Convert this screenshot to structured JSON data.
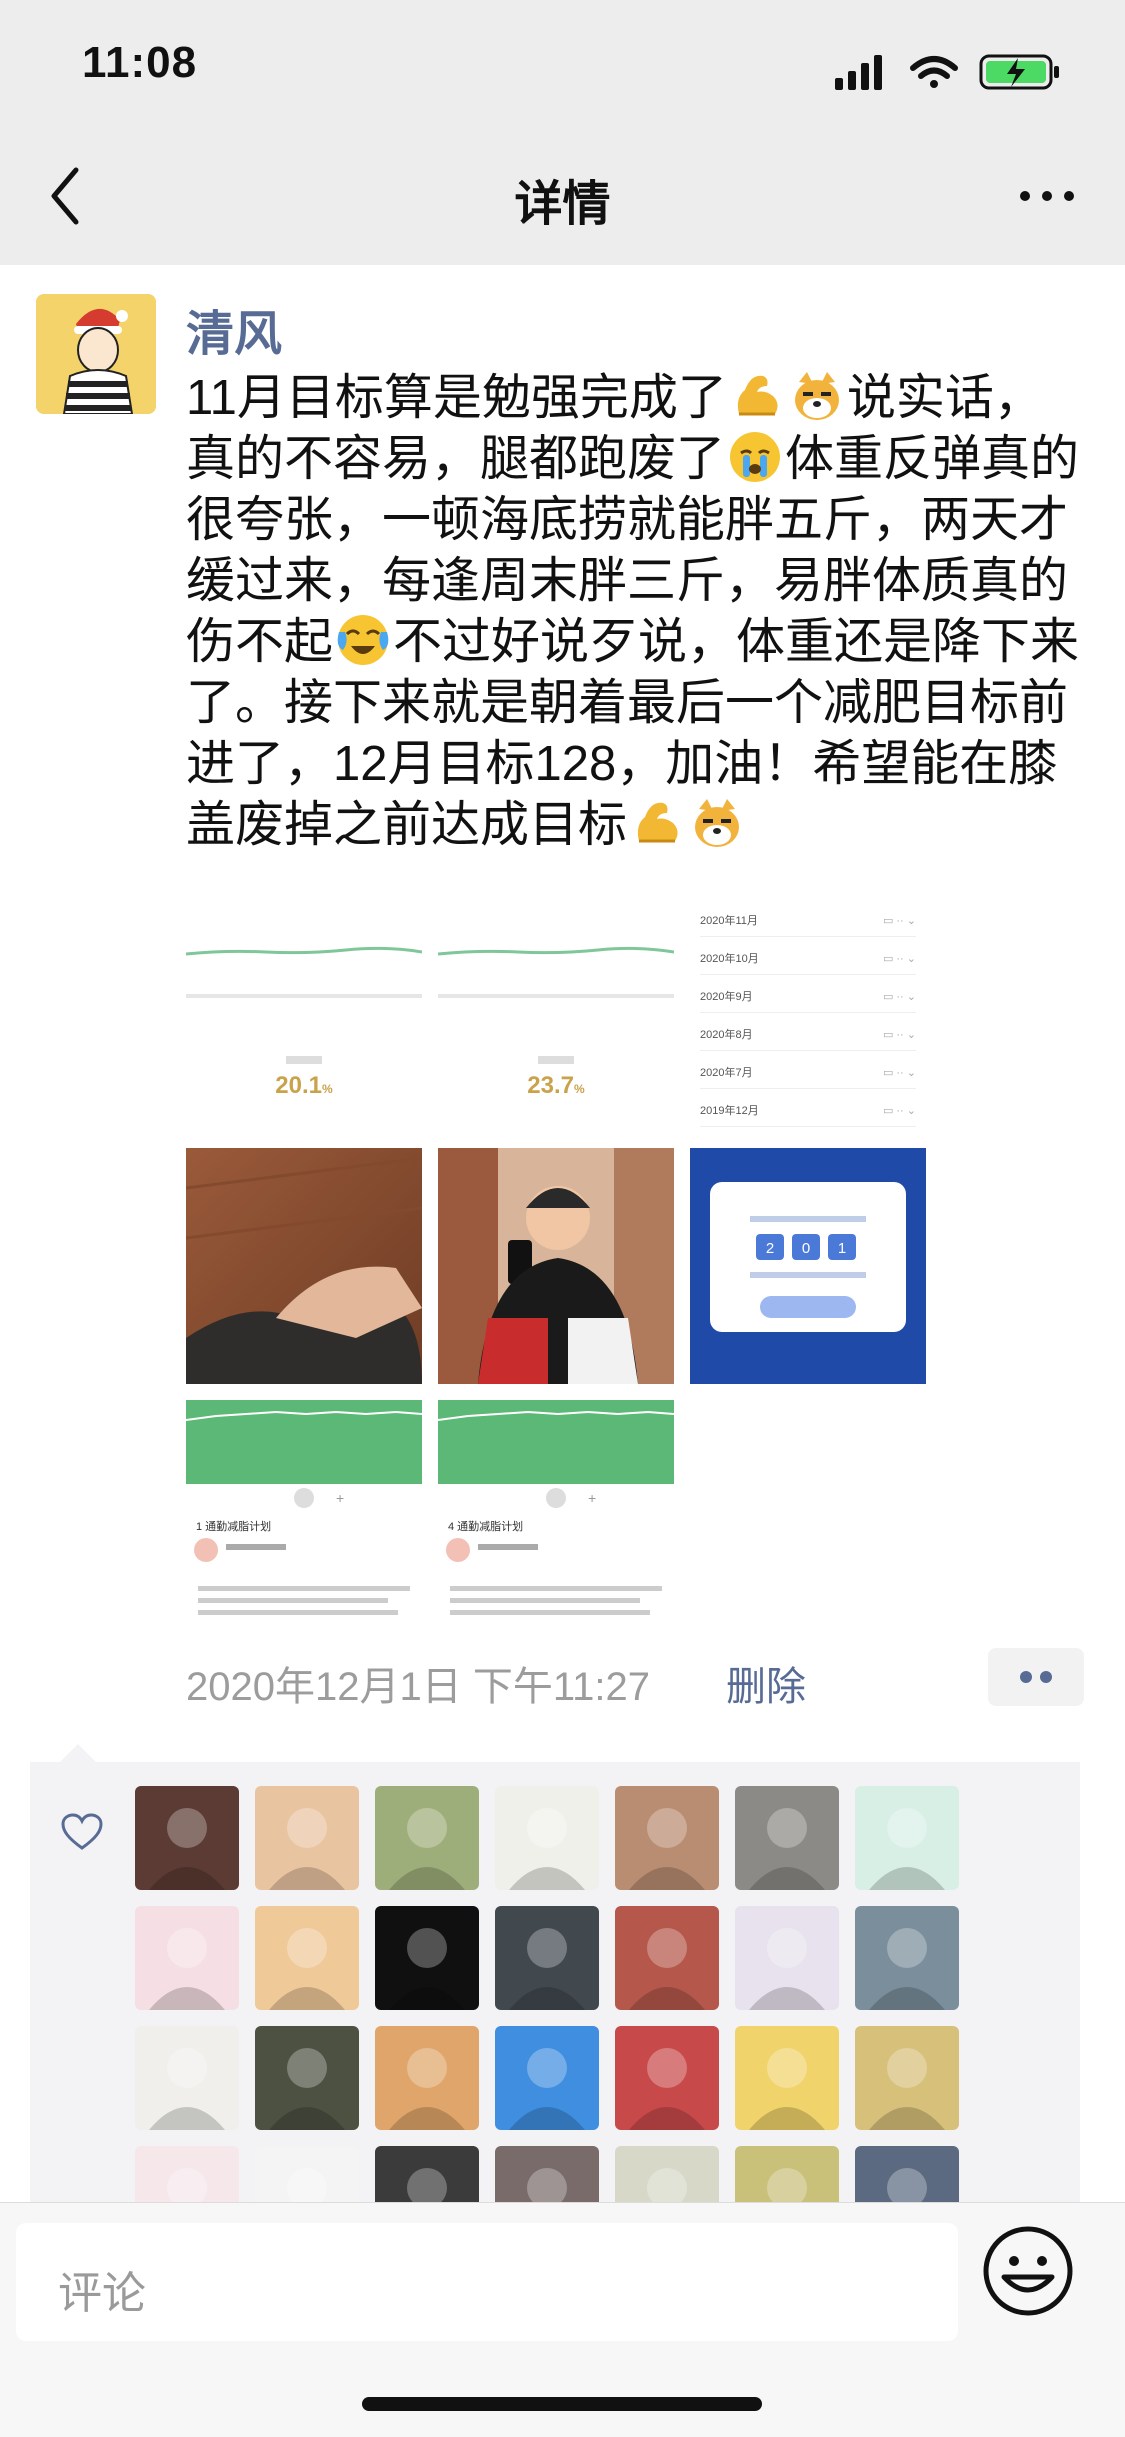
{
  "status_bar": {
    "time": "11:08",
    "icons": [
      "signal-icon",
      "wifi-icon",
      "battery-charging-icon"
    ]
  },
  "nav": {
    "title": "详情",
    "back_icon": "chevron-left-icon",
    "more_icon": "more-dots-icon"
  },
  "post": {
    "author": "清风",
    "segments": [
      {
        "t": "11月目标算是勉强完成了"
      },
      {
        "e": "muscle"
      },
      {
        "e": "dog"
      },
      {
        "t": "说实话，真的不容易，腿都跑废了"
      },
      {
        "e": "cry"
      },
      {
        "t": "体重反弹真的很夸张，一顿海底捞就能胖五斤，两天才缓过来，每逢周末胖三斤，易胖体质真的伤不起"
      },
      {
        "e": "tears"
      },
      {
        "t": "不过好说歹说，体重还是降下来了。接下来就是朝着最后一个减肥目标前进了，12月目标128，加油！希望能在膝盖废掉之前达成目标"
      },
      {
        "e": "muscle"
      },
      {
        "e": "dog"
      }
    ],
    "images": [
      {
        "kind": "stats",
        "value": "20.1",
        "unit": "%"
      },
      {
        "kind": "stats",
        "value": "23.7",
        "unit": "%"
      },
      {
        "kind": "monthlist",
        "rows": [
          "2020年11月",
          "2020年10月",
          "2020年9月",
          "2020年8月",
          "2020年7月",
          "2019年12月"
        ]
      },
      {
        "kind": "photo-floor"
      },
      {
        "kind": "photo-selfie"
      },
      {
        "kind": "app-card",
        "digits": [
          "2",
          "0",
          "1"
        ]
      },
      {
        "kind": "green-chart",
        "caption": "1 通勤减脂计划"
      },
      {
        "kind": "green-chart",
        "caption": "4 通勤减脂计划"
      }
    ],
    "timestamp": "2020年12月1日 下午11:27",
    "delete_label": "删除"
  },
  "likes": {
    "heart_icon": "heart-outline-icon",
    "avatars": [
      "#5b3b33",
      "#e9c4a1",
      "#9eae7b",
      "#f0f0ea",
      "#b98d72",
      "#8c8a86",
      "#d8efe6",
      "#f6dfe4",
      "#f0c999",
      "#101010",
      "#41494f",
      "#b5574a",
      "#e8e2ee",
      "#7b8e9c",
      "#f0efec",
      "#4c5142",
      "#e0a56a",
      "#3f8ee0",
      "#c8494a",
      "#f1d36c",
      "#d7c07a",
      "#f6e7ea",
      "#f4f4f4",
      "#3b3b3b",
      "#7a6b6b",
      "#d7d8c8",
      "#c9c07a",
      "#5b6a80"
    ]
  },
  "comment": {
    "placeholder": "评论",
    "emoji_icon": "smiley-icon"
  },
  "colors": {
    "accent": "#576b95",
    "nav_bg": "#ededed",
    "chart_green": "#5bb876"
  }
}
